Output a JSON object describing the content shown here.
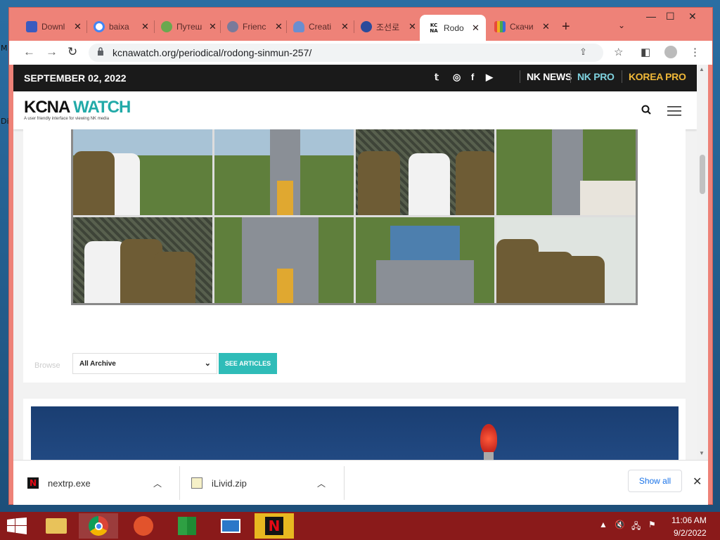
{
  "desktop": {
    "marks": [
      "M",
      "Di"
    ]
  },
  "browser": {
    "tabs": [
      {
        "title": "Downl",
        "icon": "shield-icon",
        "icon_color": "#3b5bbf"
      },
      {
        "title": "baixa",
        "icon": "google-icon",
        "icon_color": "#4285f4"
      },
      {
        "title": "Путеш",
        "icon": "route-icon",
        "icon_color": "#6aa84f"
      },
      {
        "title": "Frienc",
        "icon": "globe-icon",
        "icon_color": "#7a7a9a"
      },
      {
        "title": "Creati",
        "icon": "person-icon",
        "icon_color": "#6b8ecf"
      },
      {
        "title": "조선로",
        "icon": "emblem-icon",
        "icon_color": "#2b4b9b"
      },
      {
        "title": "Rodo",
        "icon": "kcna-icon",
        "icon_color": "#111111",
        "active": true
      },
      {
        "title": "Скачи",
        "icon": "bars-icon",
        "icon_color": "#e8a020"
      }
    ],
    "new_tab": "+",
    "tab_list": "⌄",
    "window_controls": {
      "minimize": "—",
      "maximize": "☐",
      "close": "✕"
    },
    "nav": {
      "back": "←",
      "forward": "→",
      "reload": "↻"
    },
    "url": "kcnawatch.org/periodical/rodong-sinmun-257/",
    "toolbar_icons": {
      "share": "⇪",
      "bookmark": "☆",
      "sidepanel": "◧",
      "menu": "⋮"
    }
  },
  "site": {
    "date": "SEPTEMBER 02, 2022",
    "social": [
      "𝕥",
      "◎",
      "f",
      "▶"
    ],
    "brands": [
      {
        "label": "NK NEWS",
        "color": "#ffffff"
      },
      {
        "label": "NK PRO",
        "color": "#7fd3e0"
      },
      {
        "label": "KOREA PRO",
        "color": "#f0b838"
      }
    ],
    "logo": {
      "main": "KCNA ",
      "accent": "WATCH",
      "accent_color": "#22aaa8"
    },
    "tagline": "A user friendly interface for viewing NK media",
    "browse_label": "Browse",
    "archive_select": "All Archive",
    "see_articles": "SEE ARTICLES"
  },
  "downloads": {
    "items": [
      {
        "name": "nextrp.exe",
        "icon": "netflix-file-icon"
      },
      {
        "name": "iLivid.zip",
        "icon": "zip-file-icon"
      }
    ],
    "show_all": "Show all",
    "close": "✕"
  },
  "taskbar": {
    "apps": [
      "file-explorer-icon",
      "chrome-icon",
      "headphones-app-icon",
      "store-icon",
      "mail-icon",
      "netflix-icon"
    ],
    "tray": {
      "chevron": "▲",
      "volume": "🔇",
      "network": "🖧",
      "flag": "⚑"
    },
    "time": "11:06 AM",
    "date": "9/2/2022"
  }
}
